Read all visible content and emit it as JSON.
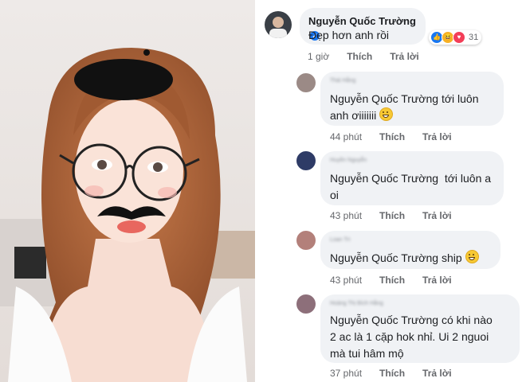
{
  "photo": {
    "description_icon": "selfie-photo-with-stickers"
  },
  "top_comment": {
    "author": "Nguyễn Quốc Trường",
    "text": "Đẹp hơn anh rồi",
    "time": "1 giờ",
    "like_label": "Thích",
    "reply_label": "Trả lời",
    "reaction_count": "31",
    "reactions": [
      "like-icon",
      "haha-icon",
      "love-icon"
    ]
  },
  "replies": [
    {
      "author": "Thái Hằng",
      "lines": [
        "Nguyễn Quốc Trường tới luôn",
        "anh ơiiiiiii"
      ],
      "emoji": "grin-emoji",
      "time": "44 phút",
      "like_label": "Thích",
      "reply_label": "Trả lời"
    },
    {
      "author": "Huyền Nguyễn",
      "lines": [
        "Nguyễn Quốc Trường  tới luôn a",
        "oi"
      ],
      "emoji": "",
      "time": "43 phút",
      "like_label": "Thích",
      "reply_label": "Trả lời"
    },
    {
      "author": "Loan Trí",
      "lines": [
        "Nguyễn Quốc Trường ship"
      ],
      "emoji": "grin-emoji",
      "time": "43 phút",
      "like_label": "Thích",
      "reply_label": "Trả lời"
    },
    {
      "author": "Hoàng Thị Bích Hằng",
      "lines": [
        "Nguyễn Quốc Trường có khi nào",
        "2 ac là 1 cặp hok nhỉ. Ui 2 nguoi",
        "mà tui hâm mộ"
      ],
      "emoji": "",
      "time": "37 phút",
      "like_label": "Thích",
      "reply_label": "Trả lời"
    }
  ],
  "colors": {
    "bubble": "#f0f2f5",
    "meta": "#65676b",
    "verified": "#1877f2",
    "like": "#1877f2",
    "love": "#f33e58",
    "haha": "#f7b125"
  }
}
